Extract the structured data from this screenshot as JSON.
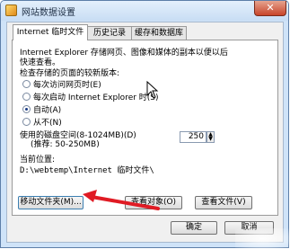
{
  "window": {
    "title": "网站数据设置",
    "close_glyph": "✕"
  },
  "tabs": [
    {
      "label": "Internet 临时文件",
      "active": true
    },
    {
      "label": "历史记录",
      "active": false
    },
    {
      "label": "缓存和数据库",
      "active": false
    }
  ],
  "panel": {
    "description_line1": "Internet Explorer 存储网页、图像和媒体的副本以便以后",
    "description_line2": "快速查看。",
    "check_label": "检查存储的页面的较新版本:",
    "options": [
      {
        "label": "每次访问网页时(E)",
        "checked": false
      },
      {
        "label": "每次启动 Internet Explorer 时(S)",
        "checked": false
      },
      {
        "label": "自动(A)",
        "checked": true
      },
      {
        "label": "从不(N)",
        "checked": false
      }
    ],
    "disk_space_label": "使用的磁盘空间(8-1024MB)(D)",
    "disk_space_recommend": "(推荐: 50-250MB)",
    "disk_space_value": "250",
    "location_label": "当前位置:",
    "location_path": "D:\\webtemp\\Internet 临时文件\\",
    "buttons": {
      "move_folder": "移动文件夹(M)...",
      "view_objects": "查看对象(O)",
      "view_files": "查看文件(V)"
    }
  },
  "footer": {
    "ok": "确定",
    "cancel": "取消"
  },
  "colors": {
    "annotation_arrow": "#e01b24",
    "window_border": "#5d7ea8"
  }
}
